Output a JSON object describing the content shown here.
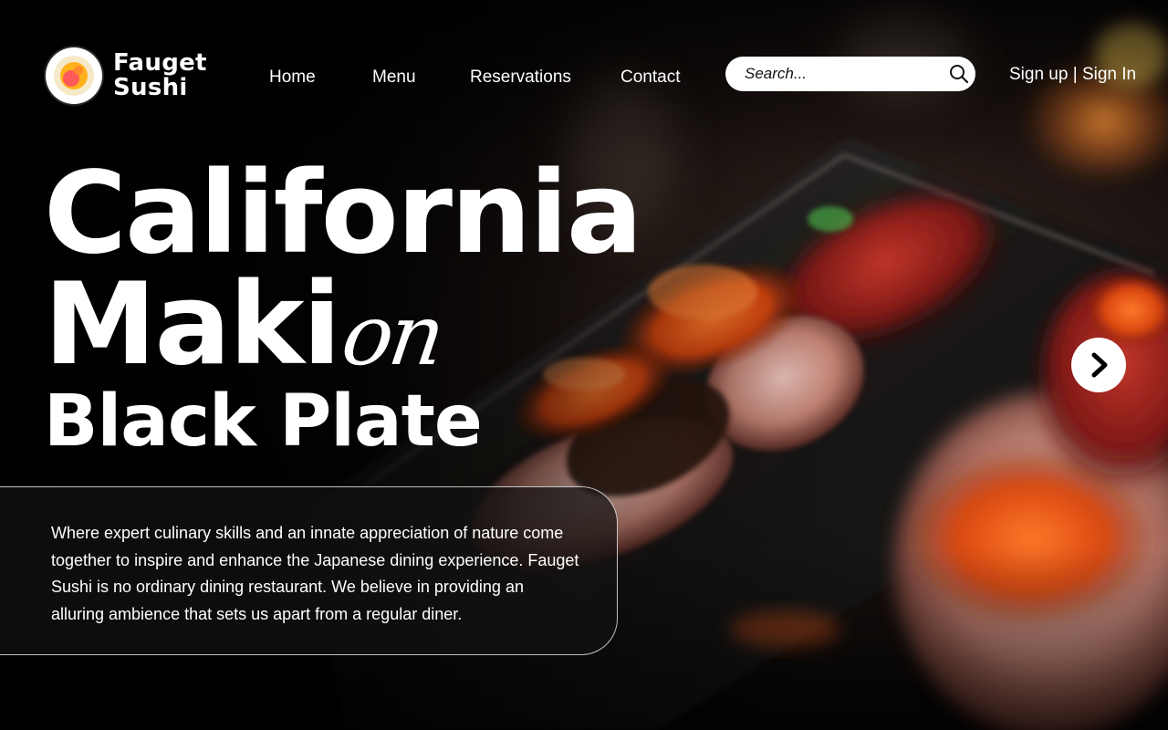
{
  "brand": {
    "name_line1": "Fauget",
    "name_line2": "Sushi"
  },
  "nav": {
    "items": [
      {
        "label": "Home"
      },
      {
        "label": "Menu"
      },
      {
        "label": "Reservations"
      },
      {
        "label": "Contact"
      }
    ]
  },
  "search": {
    "placeholder": "Search...",
    "value": ""
  },
  "auth": {
    "signup": "Sign up",
    "separator": " | ",
    "signin": "Sign In"
  },
  "hero": {
    "line1": "California",
    "line2": "Maki",
    "script": "on",
    "line3": "Black Plate",
    "description": "Where expert culinary skills and an innate appreciation of nature come together to inspire and enhance the Japanese dining experience. Fauget Sushi is no ordinary dining restaurant. We believe in providing an alluring ambience that sets us apart from a regular diner."
  },
  "icons": {
    "logo": "sushi-roll-icon",
    "search": "search-icon",
    "next": "chevron-right-icon"
  },
  "colors": {
    "background": "#050505",
    "text": "#ffffff",
    "accent_roe": "#e4571a",
    "accent_tuna": "#8a1f1a"
  }
}
